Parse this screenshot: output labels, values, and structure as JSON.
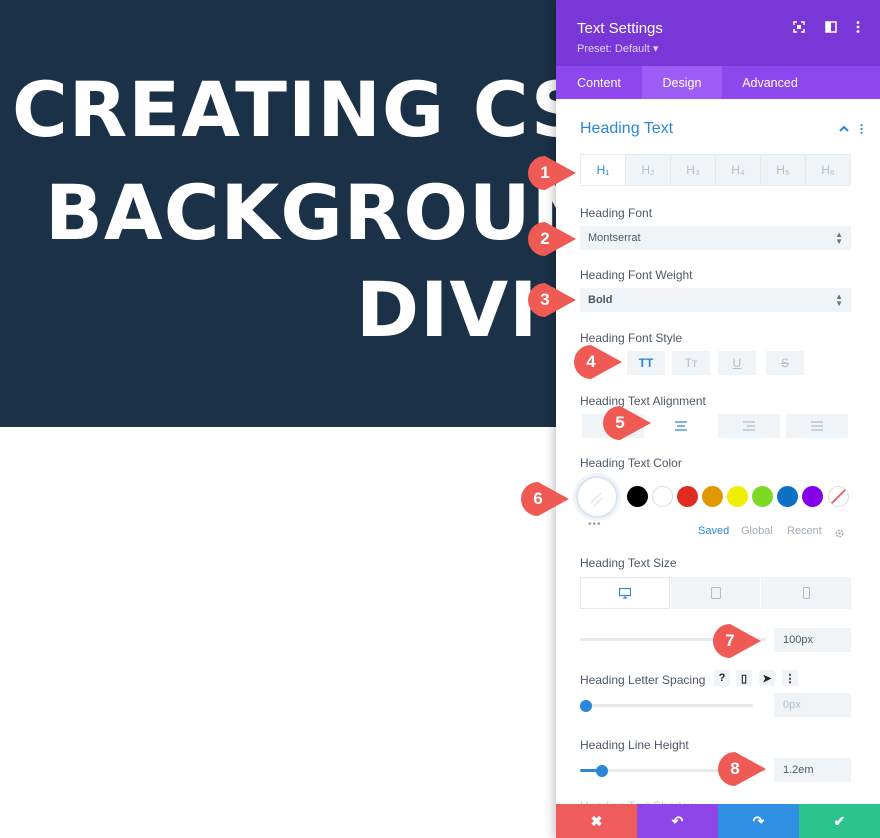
{
  "hero": {
    "lines": [
      "CREATING CSS",
      "BACKGROUND",
      "DIVI"
    ]
  },
  "panel": {
    "title": "Text Settings",
    "preset": "Preset: Default ▾",
    "header_icons": [
      "fullscreen-icon",
      "split-view-icon",
      "more-vertical-icon"
    ],
    "tabs": [
      {
        "label": "Content",
        "active": false
      },
      {
        "label": "Design",
        "active": true
      },
      {
        "label": "Advanced",
        "active": false
      }
    ],
    "section": {
      "title": "Heading Text",
      "heading_levels": [
        "H₁",
        "H₂",
        "H₃",
        "H₄",
        "H₅",
        "H₆"
      ],
      "heading_level_active": "H₁",
      "font": {
        "label": "Heading Font",
        "value": "Montserrat"
      },
      "font_weight": {
        "label": "Heading Font Weight",
        "value": "Bold"
      },
      "font_style": {
        "label": "Heading Font Style",
        "buttons": [
          "TT",
          "Tт",
          "U",
          "S"
        ],
        "active": "TT"
      },
      "alignment": {
        "label": "Heading Text Alignment",
        "active": "center"
      },
      "color": {
        "label": "Heading Text Color",
        "current": "#ffffff",
        "swatches": [
          "#000000",
          "#ffffff",
          "#e02b20",
          "#e09900",
          "#edf000",
          "#7cda24",
          "#0c71c3",
          "#8300e9"
        ],
        "more": "•••",
        "tabs": [
          "Saved",
          "Global",
          "Recent"
        ],
        "active_tab": "Saved"
      },
      "text_size": {
        "label": "Heading Text Size",
        "value": "100px",
        "device_active": "desktop"
      },
      "letter_spacing": {
        "label": "Heading Letter Spacing",
        "value": "0px",
        "help_icons": [
          "?",
          "▯",
          "➤",
          "⋮"
        ]
      },
      "line_height": {
        "label": "Heading Line Height",
        "value": "1.2em"
      },
      "cutoff_label": "Heading Text Shadow"
    },
    "footer": {
      "cancel": "✖",
      "undo": "↶",
      "redo": "↷",
      "save": "✔",
      "colors": [
        "#ef5c5c",
        "#8e46e8",
        "#2f8fe3",
        "#29c38b"
      ]
    }
  },
  "callouts": [
    "1",
    "2",
    "3",
    "4",
    "5",
    "6",
    "7",
    "8"
  ],
  "colors": {
    "hero_bg": "#1b3147",
    "accent": "#2b87da",
    "purple": "#7a37d8",
    "callout": "#ef5a55"
  }
}
